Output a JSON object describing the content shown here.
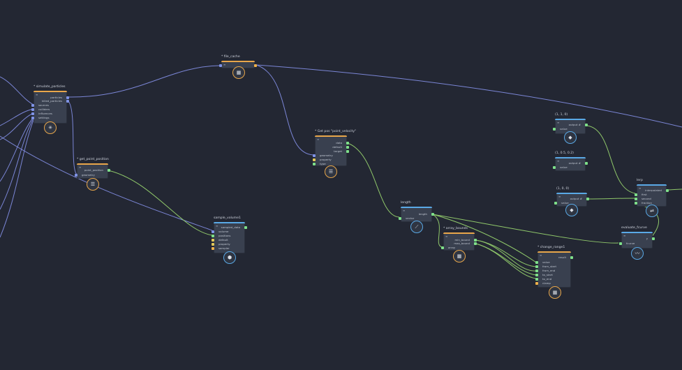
{
  "canvas": {
    "background": "#232733",
    "wire_color_blue": "#7b86d6",
    "wire_color_green": "#8fc76a"
  },
  "nodes": {
    "simulate_particles": {
      "title": "* simulate_particles",
      "menu": "≡",
      "outputs": [
        "particles",
        "killed_particles"
      ],
      "inputs": [
        "sources",
        "colliders",
        "influences",
        "settings"
      ],
      "icon": "particles-icon"
    },
    "get_point_position": {
      "title": "* get_point_position",
      "menu": "≡",
      "outputs": [
        "point_position"
      ],
      "inputs": [
        "geometry"
      ],
      "icon": "list-icon"
    },
    "file_cache": {
      "title": "* file_cache",
      "menu": "≡",
      "icon": "database-icon"
    },
    "sample_volume": {
      "title": "sample_volume1",
      "menu": "≡",
      "outputs": [
        "sampled_data"
      ],
      "inputs": [
        "volume",
        "positions",
        "default",
        "property",
        "sampler"
      ],
      "icon": "cube-icon"
    },
    "get_point_velocity": {
      "title": "* Get pos \"point_velocity\"",
      "menu": "≡",
      "outputs": [
        "data",
        "default",
        "target"
      ],
      "inputs": [
        "geometry",
        "property",
        "type"
      ],
      "icon": "list-icon"
    },
    "length": {
      "title": "length",
      "menu": "≡",
      "outputs": [
        "length"
      ],
      "inputs": [
        "vector"
      ],
      "icon": "ruler-icon"
    },
    "array_bounds": {
      "title": "* array_bounds",
      "menu": "≡",
      "outputs": [
        "min_bound",
        "max_bound"
      ],
      "inputs": [
        "array"
      ],
      "icon": "grid-icon"
    },
    "change_range": {
      "title": "* change_range1",
      "menu": "≡",
      "outputs": [
        "result"
      ],
      "inputs": [
        "value",
        "from_start",
        "from_end",
        "to_start",
        "to_end",
        "clamp"
      ],
      "icon": "grid-icon"
    },
    "const_a": {
      "title": "(1, 1, 0)",
      "menu": "≡",
      "outputs": [
        "output #"
      ],
      "inputs": [
        "value"
      ],
      "icon": "gem-icon"
    },
    "const_b": {
      "title": "(1, 0.5, 0.2)",
      "menu": "≡",
      "outputs": [
        "output #"
      ],
      "inputs": [
        "value"
      ]
    },
    "const_c": {
      "title": "(1, 0, 0)",
      "menu": "≡",
      "outputs": [
        "output #"
      ],
      "inputs": [
        "value"
      ],
      "icon": "gem-icon"
    },
    "lerp": {
      "title": "lerp",
      "menu": "≡",
      "outputs": [
        "interpolated"
      ],
      "inputs": [
        "first",
        "second",
        "fraction"
      ],
      "icon": "lerp-icon"
    },
    "evaluate_fcurve": {
      "title": "evaluate_fcurve",
      "menu": "≡",
      "inputs": [
        "fcurve"
      ],
      "outputs": [
        "y"
      ],
      "icon": "curve-icon"
    }
  }
}
